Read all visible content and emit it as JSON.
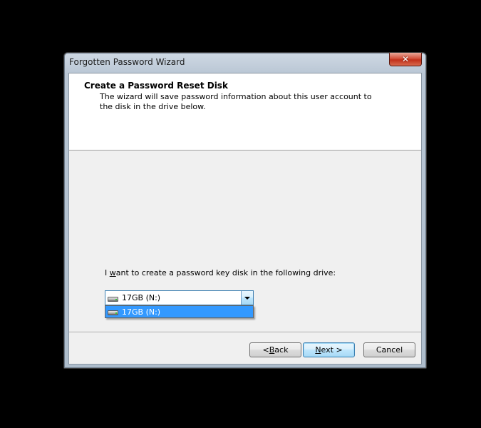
{
  "window": {
    "title": "Forgotten Password Wizard",
    "close_glyph": "✕"
  },
  "header": {
    "title": "Create a Password Reset Disk",
    "description": "The wizard will save password information about this user account to the disk in the drive below."
  },
  "main": {
    "prompt_prefix": "I ",
    "prompt_mnemonic": "w",
    "prompt_suffix": "ant to create a password key disk in the following drive:",
    "drive_select": {
      "selected_value": "17GB (N:)",
      "options": [
        "17GB (N:)"
      ],
      "icon": "drive-icon"
    }
  },
  "footer": {
    "back_prefix": "< ",
    "back_mnemonic": "B",
    "back_suffix": "ack",
    "next_mnemonic": "N",
    "next_suffix": "ext >",
    "cancel_label": "Cancel"
  },
  "colors": {
    "selection": "#3399ff",
    "close_button": "#c2301a",
    "focus_border": "#3c7fb1"
  }
}
